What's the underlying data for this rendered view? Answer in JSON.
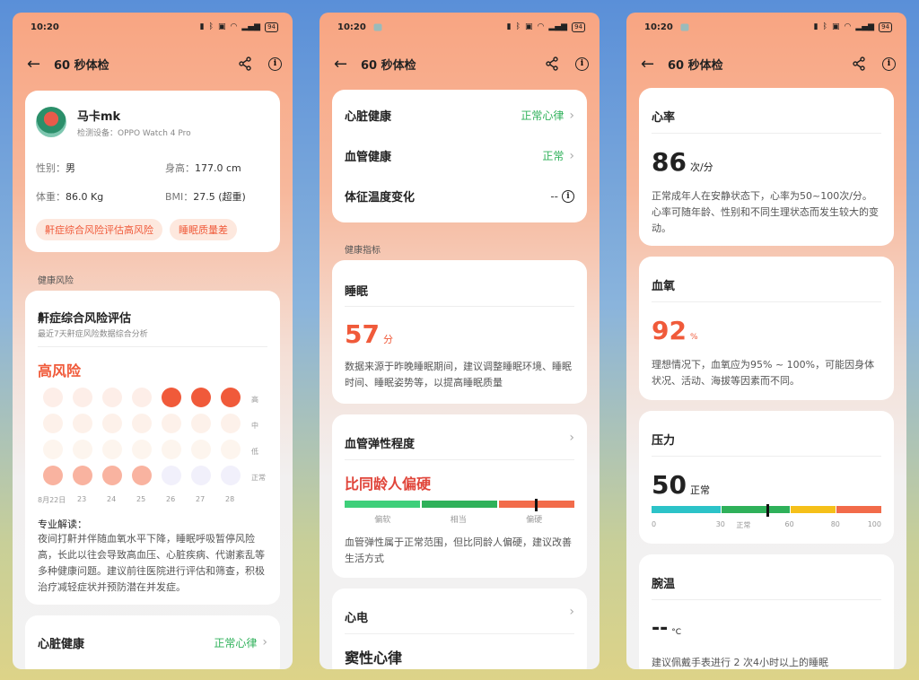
{
  "status": {
    "time": "10:20",
    "battery": "94"
  },
  "header": {
    "title": "60 秒体检"
  },
  "p1": {
    "user": {
      "name": "马卡mk",
      "device": "检测设备：OPPO Watch 4 Pro"
    },
    "info": {
      "gender_label": "性别：",
      "gender": "男",
      "height_label": "身高：",
      "height": "177.0 cm",
      "weight_label": "体重：",
      "weight": "86.0 Kg",
      "bmi_label": "BMI：",
      "bmi": "27.5 (超重)"
    },
    "tags": [
      "鼾症综合风险评估高风险",
      "睡眠质量差"
    ],
    "section": "健康风险",
    "snore": {
      "title": "鼾症综合风险评估",
      "subtitle": "最近7天鼾症风险数据综合分析",
      "level": "高风险",
      "levels": [
        "高",
        "中",
        "低",
        "正常"
      ],
      "days": [
        "8月22日",
        "23",
        "24",
        "25",
        "26",
        "27",
        "28"
      ],
      "values": [
        "正常",
        "正常",
        "正常",
        "正常",
        "高",
        "高",
        "高"
      ],
      "read_title": "专业解读：",
      "read_text": "夜间打鼾并伴随血氧水平下降，睡眠呼吸暂停风险高，长此以往会导致高血压、心脏疾病、代谢紊乱等多种健康问题。建议前往医院进行评估和筛查，积极治疗减轻症状并预防潜在并发症。"
    },
    "heart": {
      "label": "心脏健康",
      "status": "正常心律"
    }
  },
  "p2": {
    "rows": [
      {
        "label": "心脏健康",
        "status": "正常心律"
      },
      {
        "label": "血管健康",
        "status": "正常"
      },
      {
        "label": "体征温度变化",
        "status": "--"
      }
    ],
    "section": "健康指标",
    "sleep": {
      "title": "睡眠",
      "score": "57",
      "unit": "分",
      "desc": "数据来源于昨晚睡眠期间，建议调整睡眠环境、睡眠时间、睡眠姿势等，以提高睡眠质量"
    },
    "vessel": {
      "title": "血管弹性程度",
      "result": "比同龄人偏硬",
      "labels": [
        "偏软",
        "相当",
        "偏硬"
      ],
      "marker": 0.83,
      "desc": "血管弹性属于正常范围，但比同龄人偏硬，建议改善生活方式"
    },
    "ecg": {
      "title": "心电",
      "result": "窦性心律"
    }
  },
  "p3": {
    "hr": {
      "title": "心率",
      "value": "86",
      "unit": "次/分",
      "desc": "正常成年人在安静状态下，心率为50~100次/分。心率可随年龄、性别和不同生理状态而发生较大的变动。"
    },
    "spo2": {
      "title": "血氧",
      "value": "92",
      "unit": "%",
      "desc": "理想情况下，血氧应为95% ~ 100%，可能因身体状况、活动、海拔等因素而不同。"
    },
    "stress": {
      "title": "压力",
      "value": "50",
      "status": "正常",
      "ticks": [
        "0",
        "30",
        "正常",
        "60",
        "80",
        "100"
      ],
      "marker": 50
    },
    "wrist": {
      "title": "腕温",
      "value": "--",
      "unit": "°C",
      "desc": "建议佩戴手表进行 2 次4小时以上的睡眠"
    }
  },
  "colors": {
    "accent": "#f05a3a",
    "green": "#2fb15a",
    "teal": "#2cc3c8",
    "yellow": "#f5c01a"
  }
}
